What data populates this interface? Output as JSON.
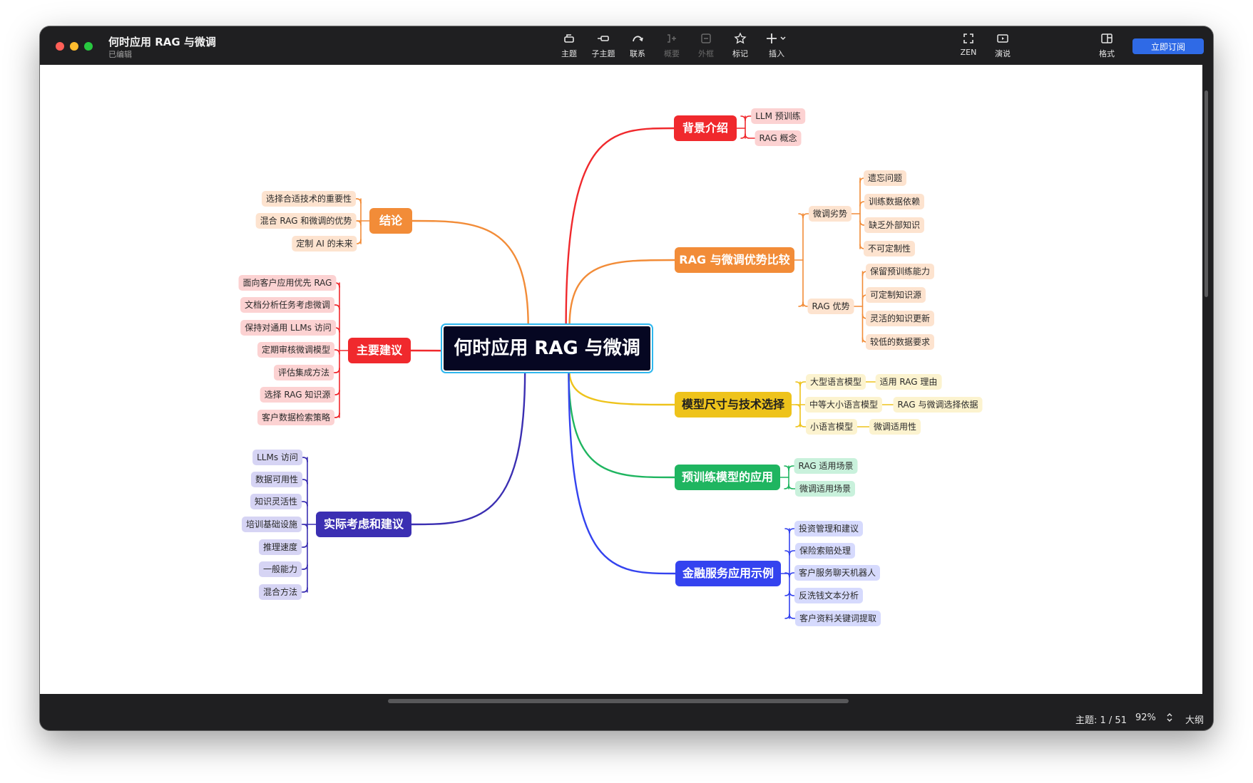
{
  "window": {
    "title": "何时应用 RAG 与微调",
    "status": "已编辑"
  },
  "toolbar": {
    "topic": "主题",
    "subtopic": "子主题",
    "relationship": "联系",
    "summary": "概要",
    "boundary": "外框",
    "marker": "标记",
    "insert": "插入",
    "zen": "ZEN",
    "present": "演说",
    "format": "格式",
    "subscribe": "立即订阅"
  },
  "status": {
    "topics": "主题: 1 / 51",
    "zoom": "92%",
    "outline": "大纲"
  },
  "colors": {
    "root": "#060722",
    "背景介绍": "#f0292d",
    "RAG 与微调优势比较": "#f28c38",
    "模型尺寸与技术选择": "#eec31b",
    "预训练模型的应用": "#1fb560",
    "金融服务应用示例": "#3443ef",
    "结论": "#f28c38",
    "主要建议": "#f0292d",
    "实际考虑和建议": "#3b2fb2"
  },
  "mindmap": {
    "root": "何时应用 RAG 与微调",
    "right": [
      {
        "label": "背景介绍",
        "children": [
          {
            "label": "LLM 预训练"
          },
          {
            "label": "RAG 概念"
          }
        ]
      },
      {
        "label": "RAG 与微调优势比较",
        "children": [
          {
            "label": "微调劣势",
            "children": [
              {
                "label": "遗忘问题"
              },
              {
                "label": "训练数据依赖"
              },
              {
                "label": "缺乏外部知识"
              },
              {
                "label": "不可定制性"
              }
            ]
          },
          {
            "label": "RAG 优势",
            "children": [
              {
                "label": "保留预训练能力"
              },
              {
                "label": "可定制知识源"
              },
              {
                "label": "灵活的知识更新"
              },
              {
                "label": "较低的数据要求"
              }
            ]
          }
        ]
      },
      {
        "label": "模型尺寸与技术选择",
        "children": [
          {
            "label": "大型语言模型",
            "children": [
              {
                "label": "适用 RAG 理由"
              }
            ]
          },
          {
            "label": "中等大小语言模型",
            "children": [
              {
                "label": "RAG 与微调选择依据"
              }
            ]
          },
          {
            "label": "小语言模型",
            "children": [
              {
                "label": "微调适用性"
              }
            ]
          }
        ]
      },
      {
        "label": "预训练模型的应用",
        "children": [
          {
            "label": "RAG 适用场景"
          },
          {
            "label": "微调适用场景"
          }
        ]
      },
      {
        "label": "金融服务应用示例",
        "children": [
          {
            "label": "投资管理和建议"
          },
          {
            "label": "保险索赔处理"
          },
          {
            "label": "客户服务聊天机器人"
          },
          {
            "label": "反洗钱文本分析"
          },
          {
            "label": "客户资料关键词提取"
          }
        ]
      }
    ],
    "left": [
      {
        "label": "结论",
        "children": [
          {
            "label": "选择合适技术的重要性"
          },
          {
            "label": "混合 RAG 和微调的优势"
          },
          {
            "label": "定制 AI 的未来"
          }
        ]
      },
      {
        "label": "主要建议",
        "children": [
          {
            "label": "面向客户应用优先 RAG"
          },
          {
            "label": "文档分析任务考虑微调"
          },
          {
            "label": "保持对通用 LLMs 访问"
          },
          {
            "label": "定期审核微调模型"
          },
          {
            "label": "评估集成方法"
          },
          {
            "label": "选择 RAG 知识源"
          },
          {
            "label": "客户数据检索策略"
          }
        ]
      },
      {
        "label": "实际考虑和建议",
        "children": [
          {
            "label": "LLMs 访问"
          },
          {
            "label": "数据可用性"
          },
          {
            "label": "知识灵活性"
          },
          {
            "label": "培训基础设施"
          },
          {
            "label": "推理速度"
          },
          {
            "label": "一般能力"
          },
          {
            "label": "混合方法"
          }
        ]
      }
    ]
  }
}
